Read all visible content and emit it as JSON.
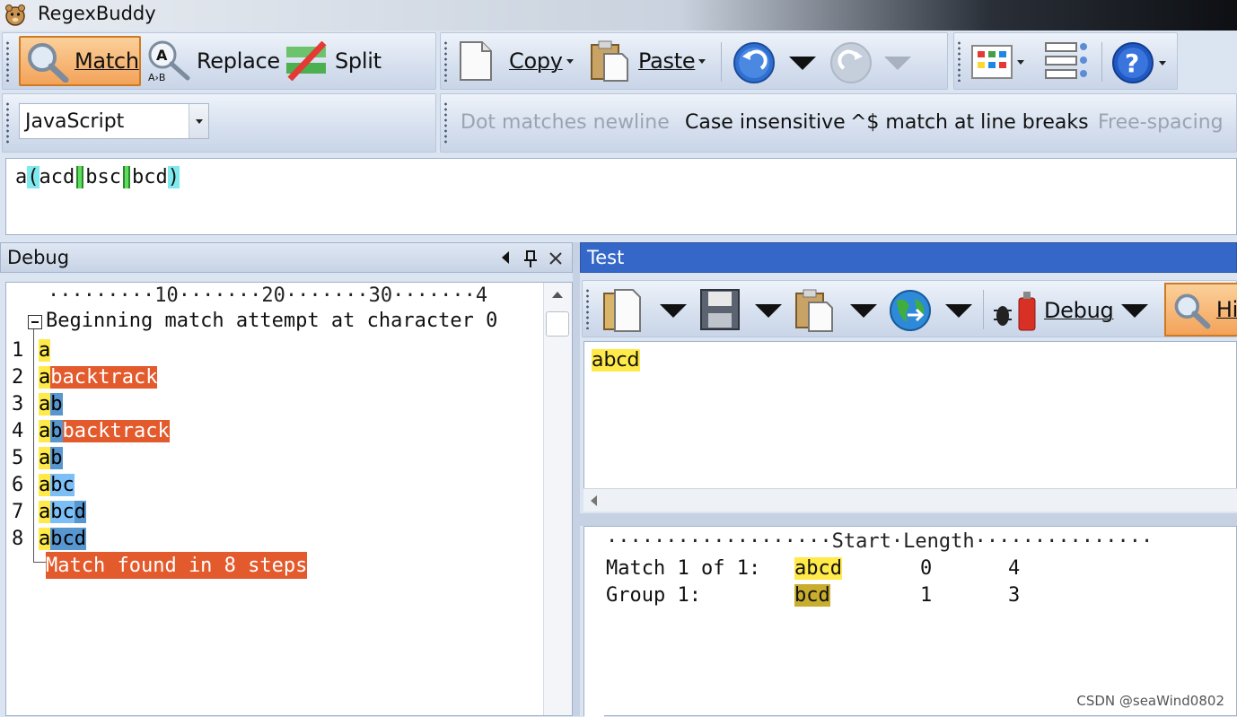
{
  "window": {
    "title": "RegexBuddy"
  },
  "toolbar": {
    "match": "Match",
    "replace": "Replace",
    "split": "Split",
    "copy": "Copy",
    "paste": "Paste"
  },
  "flavor": {
    "selected": "JavaScript"
  },
  "options": {
    "dot_newline": "Dot matches newline",
    "case_insensitive": "Case insensitive",
    "line_breaks": "^$ match at line breaks",
    "free_spacing": "Free-spacing"
  },
  "regex": {
    "a": "a",
    "open": "(",
    "alt1": "acd",
    "alt2": "bsc",
    "alt3": "bcd",
    "close": ")"
  },
  "debug": {
    "title": "Debug",
    "ruler": "·········10·······20·······30·······4",
    "heading": "Beginning match attempt at character 0",
    "rows": [
      {
        "n": "1",
        "y": "a",
        "b1": "",
        "b2": "",
        "or": ""
      },
      {
        "n": "2",
        "y": "a",
        "b1": "",
        "b2": "",
        "or": "backtrack"
      },
      {
        "n": "3",
        "y": "a",
        "b1": "",
        "b2": "b",
        "or": ""
      },
      {
        "n": "4",
        "y": "a",
        "b1": "",
        "b2": "b",
        "or": "backtrack"
      },
      {
        "n": "5",
        "y": "a",
        "b1": "",
        "b2": "b",
        "or": ""
      },
      {
        "n": "6",
        "y": "a",
        "b1": "bc",
        "b2": "",
        "or": ""
      },
      {
        "n": "7",
        "y": "a",
        "b1": "bc",
        "b2": "d",
        "or": ""
      },
      {
        "n": "8",
        "y": "a",
        "b1": "",
        "b2": "bcd",
        "or": ""
      }
    ],
    "result": "Match found in 8 steps"
  },
  "test": {
    "title": "Test",
    "debug_button": "Debug",
    "highlight_button": "Hi",
    "input": "abcd",
    "results_header": "···················Start·Length···············",
    "results": [
      {
        "label": "Match 1 of 1:",
        "value": "abcd",
        "start": "0",
        "length": "4"
      },
      {
        "label": "Group 1:",
        "value": "bcd",
        "start": "1",
        "length": "3"
      }
    ]
  },
  "watermark": "CSDN @seaWind0802",
  "colors": {
    "match_yellow": "#ffea4a",
    "backtrack": "#e35a2d",
    "test_header": "#3567c9"
  }
}
